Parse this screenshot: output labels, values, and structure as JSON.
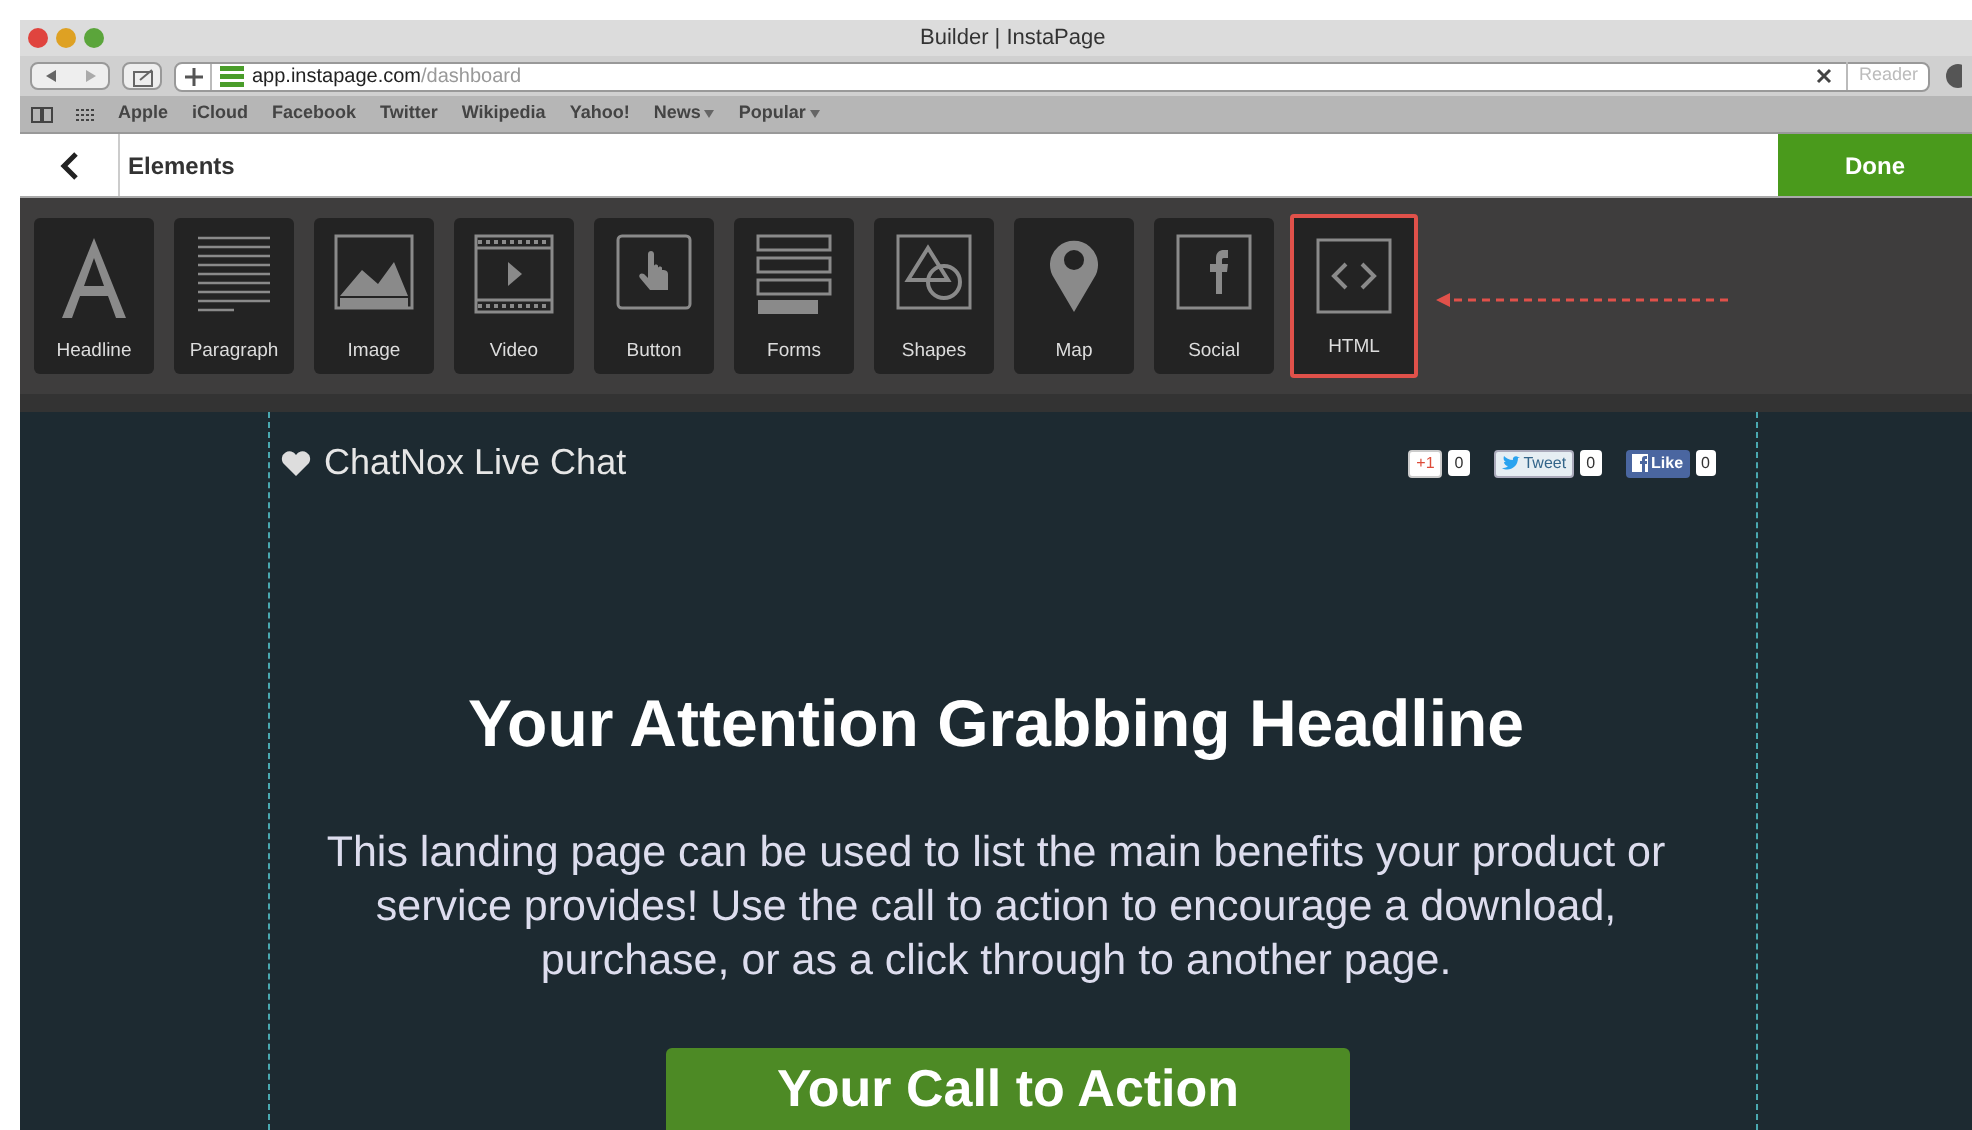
{
  "window": {
    "title": "Builder | InstaPage"
  },
  "address_bar": {
    "host": "app.instapage.com",
    "path": "/dashboard",
    "reader": "Reader"
  },
  "bookmarks": [
    {
      "label": "Apple"
    },
    {
      "label": "iCloud"
    },
    {
      "label": "Facebook"
    },
    {
      "label": "Twitter"
    },
    {
      "label": "Wikipedia"
    },
    {
      "label": "Yahoo!"
    },
    {
      "label": "News",
      "menu": true
    },
    {
      "label": "Popular",
      "menu": true
    }
  ],
  "header": {
    "title": "Elements",
    "done": "Done"
  },
  "elements": [
    {
      "label": "Headline",
      "selected": false
    },
    {
      "label": "Paragraph",
      "selected": false
    },
    {
      "label": "Image",
      "selected": false
    },
    {
      "label": "Video",
      "selected": false
    },
    {
      "label": "Button",
      "selected": false
    },
    {
      "label": "Forms",
      "selected": false
    },
    {
      "label": "Shapes",
      "selected": false
    },
    {
      "label": "Map",
      "selected": false
    },
    {
      "label": "Social",
      "selected": false
    },
    {
      "label": "HTML",
      "selected": true
    }
  ],
  "page": {
    "brand": "ChatNox Live Chat",
    "social": [
      {
        "label": "+1",
        "count": "0"
      },
      {
        "label": "Tweet",
        "count": "0"
      },
      {
        "label": "Like",
        "count": "0"
      }
    ],
    "headline": "Your Attention Grabbing Headline",
    "body": "This landing page can be used to list the main benefits your product or service provides! Use the call to action to encourage a download, purchase, or as a click through to another page.",
    "cta": "Your Call to Action"
  }
}
